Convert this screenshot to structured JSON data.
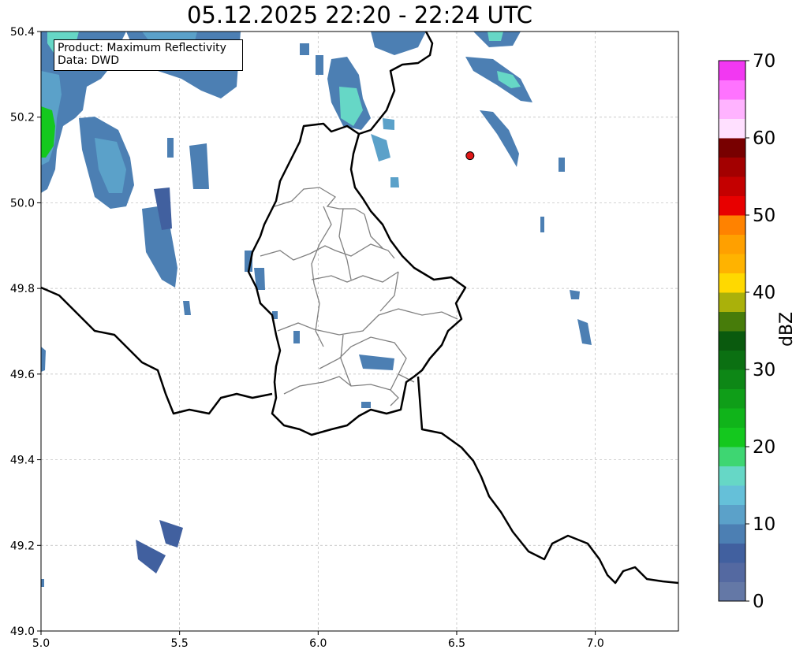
{
  "title": "05.12.2025 22:20 - 22:24 UTC",
  "info_box": {
    "product_line": "Product: Maximum Reflectivity",
    "data_line": "Data: DWD"
  },
  "colorbar": {
    "label": "dBZ",
    "ticks": [
      0,
      10,
      20,
      30,
      40,
      50,
      60,
      70
    ],
    "range": [
      0,
      70
    ],
    "step": 2.5,
    "colors": [
      "#6478a6",
      "#5469a1",
      "#41609f",
      "#4c7fb3",
      "#5ba1c9",
      "#65c0d9",
      "#66d7c6",
      "#3ed672",
      "#14c81e",
      "#10b41a",
      "#0f9e18",
      "#0d8716",
      "#0b7012",
      "#0a5a0e",
      "#477c0a",
      "#aab10a",
      "#ffd900",
      "#ffb300",
      "#ffa000",
      "#ff8200",
      "#e80000",
      "#c40000",
      "#a30000",
      "#780000",
      "#ffe0ff",
      "#ffb3ff",
      "#ff73ff",
      "#f238f2"
    ]
  },
  "axes": {
    "xlim": [
      5.0,
      7.3
    ],
    "ylim": [
      49.0,
      50.4
    ],
    "xticks": [
      "5.0",
      "5.5",
      "6.0",
      "6.5",
      "7.0"
    ],
    "yticks": [
      "49.0",
      "49.2",
      "49.4",
      "49.6",
      "49.8",
      "50.0",
      "50.2",
      "50.4"
    ],
    "grid": true
  },
  "station": {
    "lon": 6.548,
    "lat": 50.11,
    "color": "#e01818"
  },
  "colors": {
    "border": "#000000",
    "admin": "#808080",
    "grid": "#bbbbbb"
  }
}
